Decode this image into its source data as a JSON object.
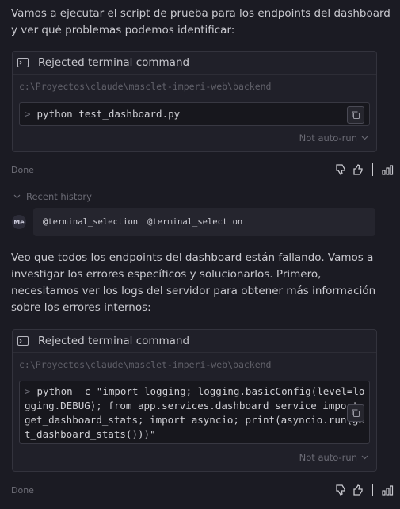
{
  "messages": {
    "intro": "Vamos a ejecutar el script de prueba para los endpoints del dashboard y ver qué problemas podemos identificar:",
    "followup": "Veo que todos los endpoints del dashboard están fallando. Vamos a investigar los errores específicos y solucionarlos. Primero, necesitamos ver los logs del servidor para obtener más información sobre los errores internos:"
  },
  "card1": {
    "title": "Rejected terminal command",
    "path": "c:\\Proyectos\\claude\\masclet-imperi-web\\backend",
    "prompt": ">",
    "command": "python test_dashboard.py",
    "autorun": "Not auto-run"
  },
  "card2": {
    "title": "Rejected terminal command",
    "path": "c:\\Proyectos\\claude\\masclet-imperi-web\\backend",
    "prompt": ">",
    "command_lines": [
      "python -c \"import logging; logging.basicConfig(level=lo",
      "gging.DEBUG); from app.services.dashboard_service import",
      "get_dashboard_stats; import asyncio; print(asyncio.run(ge",
      "t_dashboard_stats()))\""
    ],
    "autorun": "Not auto-run"
  },
  "status": {
    "done1": "Done",
    "done2": "Done"
  },
  "history": {
    "label": "Recent history"
  },
  "user": {
    "avatar": "Me",
    "chips": [
      "@terminal_selection",
      "@terminal_selection"
    ]
  },
  "colors": {
    "background": "#1b1b23",
    "card": "#202029",
    "border": "#33333d",
    "text": "#c9c9cf"
  }
}
